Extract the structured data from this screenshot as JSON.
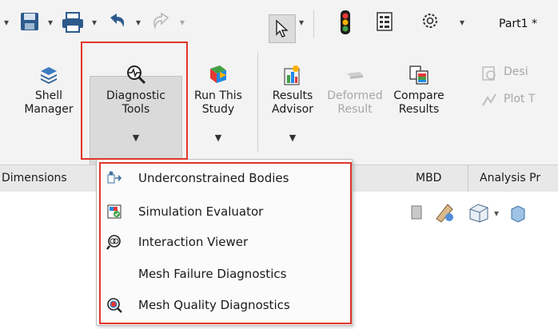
{
  "quick_access": {
    "save_icon": "save-icon",
    "print_icon": "print-icon",
    "undo_icon": "undo-icon",
    "redo_icon": "redo-icon",
    "select_icon": "select-cursor-icon",
    "traffic_light_icon": "traffic-light-icon",
    "file_props_icon": "file-properties-icon",
    "options_icon": "options-gear-icon",
    "document_title": "Part1 *"
  },
  "ribbon": {
    "shell_manager": "Shell\nManager",
    "diagnostic_tools": "Diagnostic\nTools",
    "run_this_study": "Run This\nStudy",
    "results_advisor": "Results\nAdvisor",
    "deformed_result": "Deformed\nResult",
    "compare_results": "Compare\nResults",
    "design_partial": "Desi",
    "plot_partial": "Plot T"
  },
  "tabs": {
    "dimensions": "Dimensions",
    "mbd": "MBD",
    "analysis": "Analysis Pr"
  },
  "menu": {
    "items": [
      {
        "label": "Underconstrained Bodies",
        "icon": "underconstrained-bodies-icon"
      },
      {
        "label": "Simulation Evaluator",
        "icon": "simulation-evaluator-icon"
      },
      {
        "label": "Interaction Viewer",
        "icon": "interaction-viewer-icon"
      },
      {
        "label": "Mesh Failure Diagnostics",
        "icon": ""
      },
      {
        "label": "Mesh Quality Diagnostics",
        "icon": "mesh-quality-icon"
      }
    ]
  },
  "colors": {
    "highlight": "#e0352b",
    "toolbar_bg": "#f3f3f3",
    "pressed_bg": "#dadada"
  }
}
